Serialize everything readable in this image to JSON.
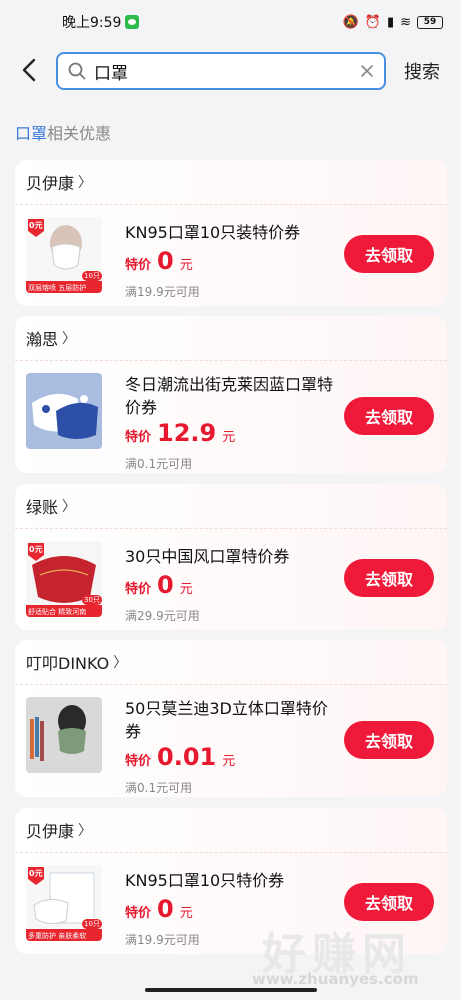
{
  "status": {
    "time": "晚上9:59",
    "battery": "59"
  },
  "search": {
    "back_icon": "chevron-left-icon",
    "value": "口罩",
    "clear_icon": "close-icon",
    "search_label": "搜索"
  },
  "related": {
    "keyword": "口罩",
    "suffix": "相关优惠"
  },
  "coupons": [
    {
      "shop": "贝伊康",
      "title": "KN95口罩10只装特价券",
      "price_label": "特价",
      "price": "0",
      "unit": "元",
      "condition": "满19.9元可用",
      "button": "去领取",
      "thumb_tag": "0元",
      "thumb_caption": "双层熔喷 五层防护",
      "thumb_badge": "10只"
    },
    {
      "shop": "瀚思",
      "title": "冬日潮流出街克莱因蓝口罩特价券",
      "price_label": "特价",
      "price": "12.9",
      "unit": "元",
      "condition": "满0.1元可用",
      "button": "去领取",
      "thumb_tag": "",
      "thumb_caption": "",
      "thumb_badge": ""
    },
    {
      "shop": "绿账",
      "title": "30只中国风口罩特价券",
      "price_label": "特价",
      "price": "0",
      "unit": "元",
      "condition": "满29.9元可用",
      "button": "去领取",
      "thumb_tag": "0元",
      "thumb_caption": "舒适贴合 精致河南",
      "thumb_badge": "30只"
    },
    {
      "shop": "叮叩DINKO",
      "title": "50只莫兰迪3D立体口罩特价券",
      "price_label": "特价",
      "price": "0.01",
      "unit": "元",
      "condition": "满0.1元可用",
      "button": "去领取",
      "thumb_tag": "",
      "thumb_caption": "",
      "thumb_badge": ""
    },
    {
      "shop": "贝伊康",
      "title": "KN95口罩10只特价券",
      "price_label": "特价",
      "price": "0",
      "unit": "元",
      "condition": "满19.9元可用",
      "button": "去领取",
      "thumb_tag": "0元",
      "thumb_caption": "多重防护 亲肤柔软",
      "thumb_badge": "10只"
    }
  ],
  "watermark": {
    "big": "好赚网",
    "small": "www.zhuanyes.com"
  },
  "colors": {
    "accent_red": "#ef1a3a",
    "price_red": "#e6192e",
    "search_border": "#4a90e2",
    "keyword_blue": "#3a7ad8"
  }
}
